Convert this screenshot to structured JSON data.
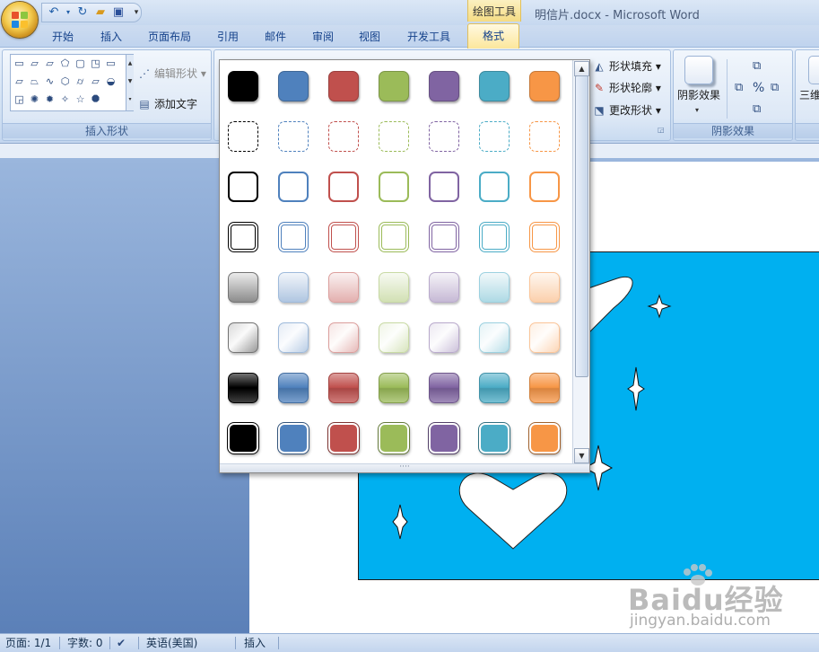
{
  "window": {
    "title": "明信片.docx - Microsoft Word",
    "context_tab_group": "绘图工具"
  },
  "tabs": [
    "开始",
    "插入",
    "页面布局",
    "引用",
    "邮件",
    "审阅",
    "视图",
    "开发工具"
  ],
  "active_tab": "格式",
  "ribbon": {
    "insert_shapes": {
      "label": "插入形状",
      "edit_shape": "编辑形状",
      "add_text": "添加文字"
    },
    "shape_styles": {
      "fill": "形状填充",
      "outline": "形状轮廓",
      "change": "更改形状"
    },
    "shadow_effects": {
      "label": "阴影效果",
      "button": "阴影效果"
    },
    "three_d": {
      "button": "三维"
    }
  },
  "style_gallery": {
    "colors": [
      "#000000",
      "#4f81bd",
      "#c0504d",
      "#9bbb59",
      "#8064a2",
      "#4bacc6",
      "#f79646"
    ],
    "rows": [
      "solid",
      "dashed",
      "outline",
      "double-outline",
      "light-gradient",
      "pale-gradient",
      "gloss",
      "bordered-solid"
    ]
  },
  "statusbar": {
    "page": "页面: 1/1",
    "words": "字数: 0",
    "language": "英语(美国)",
    "mode": "插入"
  },
  "watermark": {
    "logo": "Baidu经验",
    "url": "jingyan.baidu.com"
  }
}
